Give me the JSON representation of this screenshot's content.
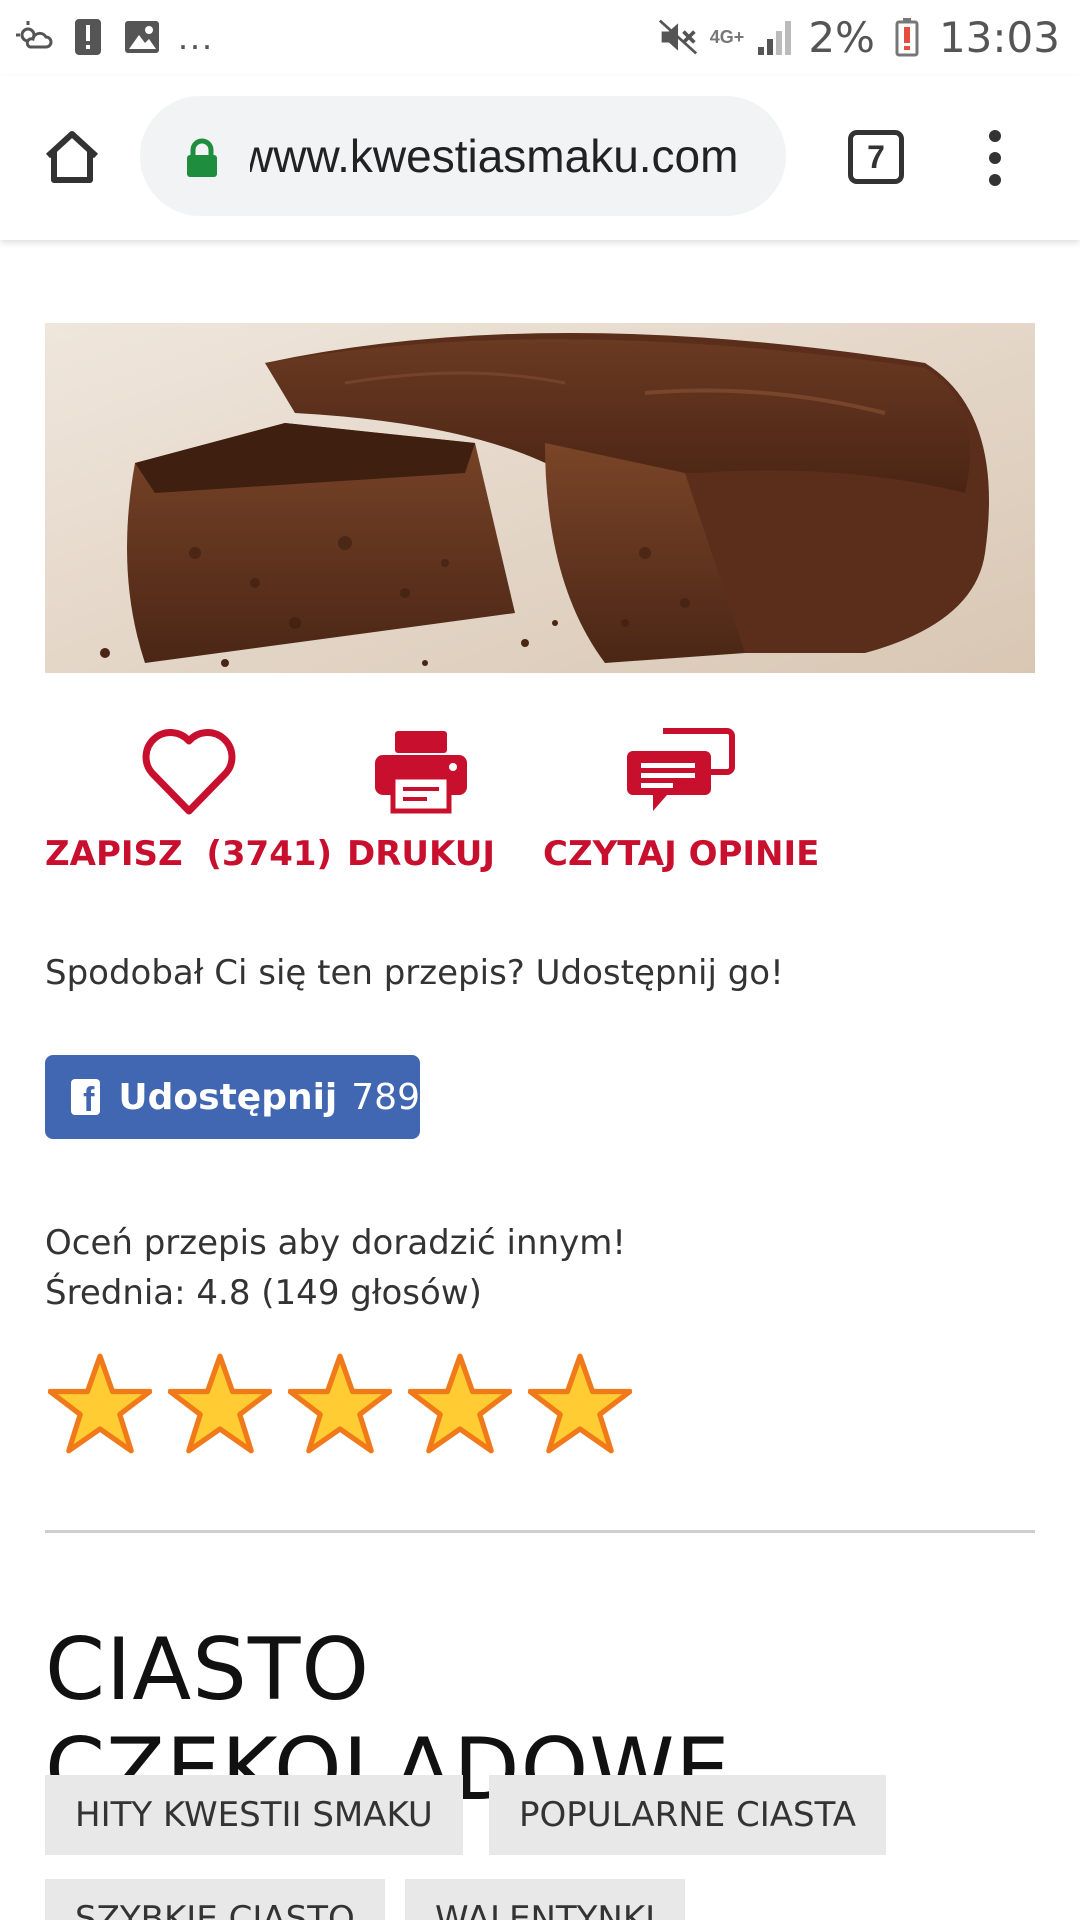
{
  "status_bar": {
    "battery_percent": "2%",
    "time": "13:03",
    "network": "4G+",
    "overflow": "..."
  },
  "browser": {
    "url": "www.kwestiasmaku.com",
    "tab_count": "7"
  },
  "colors": {
    "accent": "#c8102e",
    "facebook": "#4267b2",
    "star_fill": "#ffcc33",
    "star_stroke": "#f07a1a"
  },
  "actions": {
    "save_label": "ZAPISZ  (3741)",
    "print_label": "DRUKUJ",
    "reviews_label": "CZYTAJ OPINIE"
  },
  "share": {
    "prompt": "Spodobał Ci się ten przepis? Udostępnij go!",
    "facebook_label": "Udostępnij",
    "facebook_count": "789"
  },
  "rating": {
    "prompt": "Oceń przepis aby doradzić innym!",
    "average": "Średnia: 4.8 (149 głosów)",
    "stars": 5
  },
  "recipe": {
    "title": "CIASTO CZEKOLADOWE"
  },
  "tags": [
    "HITY KWESTII SMAKU",
    "POPULARNE CIASTA",
    "SZYBKIE CIASTO",
    "WALENTYNKI"
  ]
}
